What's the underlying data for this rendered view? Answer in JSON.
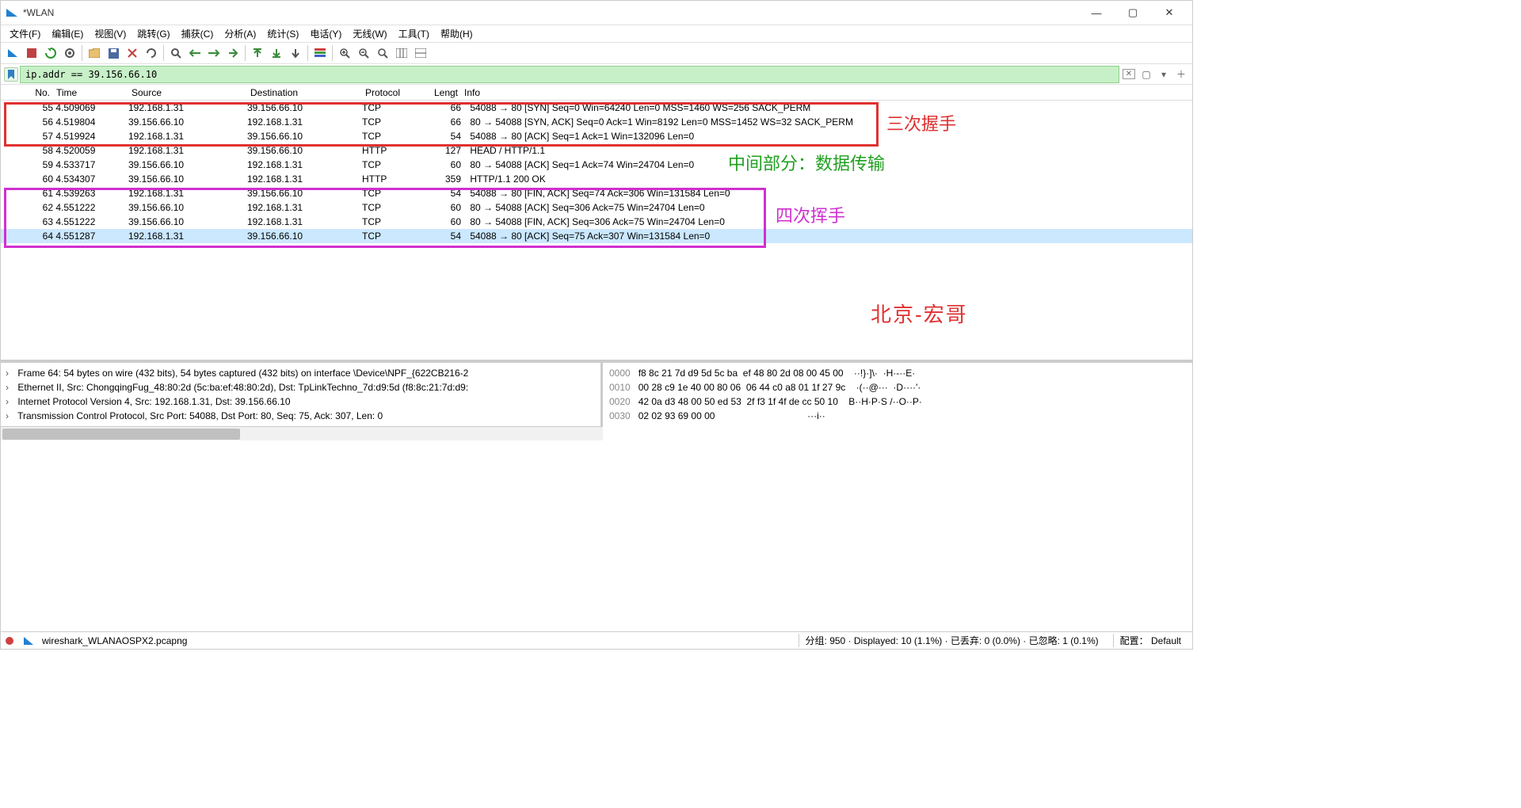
{
  "window": {
    "title": "*WLAN"
  },
  "win_buttons": {
    "min": "—",
    "max": "▢",
    "close": "✕"
  },
  "menu": {
    "file": "文件(F)",
    "edit": "编辑(E)",
    "view": "视图(V)",
    "go": "跳转(G)",
    "capture": "捕获(C)",
    "analyze": "分析(A)",
    "statistics": "统计(S)",
    "telephony": "电话(Y)",
    "wireless": "无线(W)",
    "tools": "工具(T)",
    "help": "帮助(H)"
  },
  "filter": {
    "value": "ip.addr == 39.156.66.10"
  },
  "columns": {
    "no": "No.",
    "time": "Time",
    "source": "Source",
    "dest": "Destination",
    "proto": "Protocol",
    "len": "Lengt",
    "info": "Info"
  },
  "packets": [
    {
      "no": "55",
      "time": "4.509069",
      "src": "192.168.1.31",
      "dst": "39.156.66.10",
      "proto": "TCP",
      "len": "66",
      "info": "54088 → 80 [SYN] Seq=0 Win=64240 Len=0 MSS=1460 WS=256 SACK_PERM"
    },
    {
      "no": "56",
      "time": "4.519804",
      "src": "39.156.66.10",
      "dst": "192.168.1.31",
      "proto": "TCP",
      "len": "66",
      "info": "80 → 54088 [SYN, ACK] Seq=0 Ack=1 Win=8192 Len=0 MSS=1452 WS=32 SACK_PERM"
    },
    {
      "no": "57",
      "time": "4.519924",
      "src": "192.168.1.31",
      "dst": "39.156.66.10",
      "proto": "TCP",
      "len": "54",
      "info": "54088 → 80 [ACK] Seq=1 Ack=1 Win=132096 Len=0"
    },
    {
      "no": "58",
      "time": "4.520059",
      "src": "192.168.1.31",
      "dst": "39.156.66.10",
      "proto": "HTTP",
      "len": "127",
      "info": "HEAD / HTTP/1.1"
    },
    {
      "no": "59",
      "time": "4.533717",
      "src": "39.156.66.10",
      "dst": "192.168.1.31",
      "proto": "TCP",
      "len": "60",
      "info": "80 → 54088 [ACK] Seq=1 Ack=74 Win=24704 Len=0"
    },
    {
      "no": "60",
      "time": "4.534307",
      "src": "39.156.66.10",
      "dst": "192.168.1.31",
      "proto": "HTTP",
      "len": "359",
      "info": "HTTP/1.1 200 OK"
    },
    {
      "no": "61",
      "time": "4.539263",
      "src": "192.168.1.31",
      "dst": "39.156.66.10",
      "proto": "TCP",
      "len": "54",
      "info": "54088 → 80 [FIN, ACK] Seq=74 Ack=306 Win=131584 Len=0"
    },
    {
      "no": "62",
      "time": "4.551222",
      "src": "39.156.66.10",
      "dst": "192.168.1.31",
      "proto": "TCP",
      "len": "60",
      "info": "80 → 54088 [ACK] Seq=306 Ack=75 Win=24704 Len=0"
    },
    {
      "no": "63",
      "time": "4.551222",
      "src": "39.156.66.10",
      "dst": "192.168.1.31",
      "proto": "TCP",
      "len": "60",
      "info": "80 → 54088 [FIN, ACK] Seq=306 Ack=75 Win=24704 Len=0"
    },
    {
      "no": "64",
      "time": "4.551287",
      "src": "192.168.1.31",
      "dst": "39.156.66.10",
      "proto": "TCP",
      "len": "54",
      "info": "54088 → 80 [ACK] Seq=75 Ack=307 Win=131584 Len=0",
      "selected": true
    }
  ],
  "annotations": {
    "handshake": "三次握手",
    "middle": "中间部分：数据传输",
    "wave": "四次挥手",
    "author": "北京-宏哥"
  },
  "tree": [
    "Frame 64: 54 bytes on wire (432 bits), 54 bytes captured (432 bits) on interface \\Device\\NPF_{622CB216-2",
    "Ethernet II, Src: ChongqingFug_48:80:2d (5c:ba:ef:48:80:2d), Dst: TpLinkTechno_7d:d9:5d (f8:8c:21:7d:d9:",
    "Internet Protocol Version 4, Src: 192.168.1.31, Dst: 39.156.66.10",
    "Transmission Control Protocol, Src Port: 54088, Dst Port: 80, Seq: 75, Ack: 307, Len: 0"
  ],
  "hex": [
    {
      "off": "0000",
      "hex": "f8 8c 21 7d d9 5d 5c ba  ef 48 80 2d 08 00 45 00",
      "ascii": "··!}·]\\·  ·H·-··E·"
    },
    {
      "off": "0010",
      "hex": "00 28 c9 1e 40 00 80 06  06 44 c0 a8 01 1f 27 9c",
      "ascii": "·(··@···  ·D····'·"
    },
    {
      "off": "0020",
      "hex": "42 0a d3 48 00 50 ed 53  2f f3 1f 4f de cc 50 10",
      "ascii": "B··H·P·S /··O··P·"
    },
    {
      "off": "0030",
      "hex": "02 02 93 69 00 00",
      "ascii": "···i··"
    }
  ],
  "status": {
    "file": "wireshark_WLANAOSPX2.pcapng",
    "stats": "分组: 950 · Displayed: 10 (1.1%) · 已丢弃: 0 (0.0%) · 已忽略: 1 (0.1%)",
    "profile": "配置： Default"
  }
}
